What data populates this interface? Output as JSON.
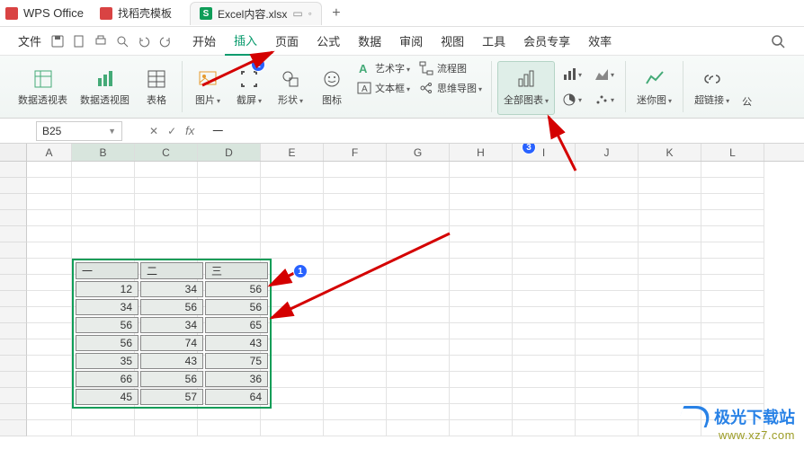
{
  "app": {
    "name": "WPS Office"
  },
  "tabs": {
    "template_tab": "找稻壳模板",
    "active_tab": "Excel内容.xlsx",
    "active_initial": "S"
  },
  "menu": {
    "file": "文件",
    "start": "开始",
    "insert": "插入",
    "page": "页面",
    "formula": "公式",
    "data": "数据",
    "review": "审阅",
    "view": "视图",
    "tools": "工具",
    "member": "会员专享",
    "efficiency": "效率"
  },
  "ribbon": {
    "pivot_table": "数据透视表",
    "pivot_chart": "数据透视图",
    "table": "表格",
    "picture": "图片",
    "screenshot": "截屏",
    "shape": "形状",
    "icon": "图标",
    "wordart": "艺术字",
    "textbox": "文本框",
    "flowchart": "流程图",
    "mindmap": "思维导图",
    "all_charts": "全部图表",
    "sparkline": "迷你图",
    "hyperlink": "超链接",
    "fx": "公"
  },
  "namebox": "B25",
  "formula_value": "一",
  "columns": [
    "A",
    "B",
    "C",
    "D",
    "E",
    "F",
    "G",
    "H",
    "I",
    "J",
    "K",
    "L"
  ],
  "badges": {
    "b1": "1",
    "b2": "2",
    "b3": "3"
  },
  "table": {
    "headers": [
      "一",
      "二",
      "三"
    ],
    "rows": [
      [
        12,
        34,
        56
      ],
      [
        34,
        56,
        56
      ],
      [
        56,
        34,
        65
      ],
      [
        56,
        74,
        43
      ],
      [
        35,
        43,
        75
      ],
      [
        66,
        56,
        36
      ],
      [
        45,
        57,
        64
      ]
    ]
  },
  "watermark": {
    "brand": "极光下载站",
    "url": "www.xz7.com"
  }
}
